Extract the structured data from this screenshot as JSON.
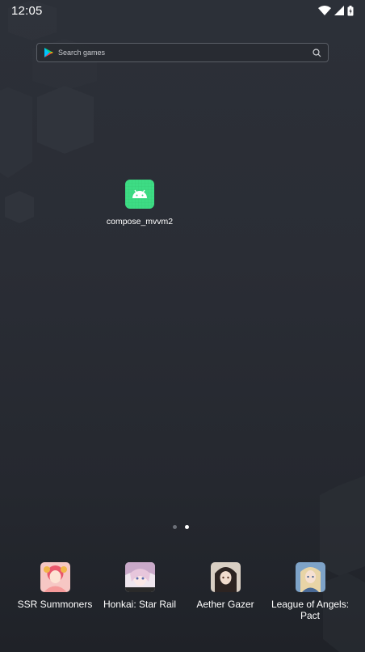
{
  "status_bar": {
    "time": "12:05",
    "icons": [
      "wifi-icon",
      "signal-icon",
      "battery-icon"
    ]
  },
  "search": {
    "placeholder": "Search games",
    "icons": [
      "play-store-icon",
      "search-icon"
    ]
  },
  "home_apps": [
    {
      "label": "compose_mvvm2",
      "icon": "android-icon",
      "color": "#3ddc84"
    }
  ],
  "page_indicator": {
    "pages": 2,
    "current": 2
  },
  "dock": [
    {
      "label": "SSR Summoners",
      "icon": "ssr-summoners-icon"
    },
    {
      "label": "Honkai: Star Rail",
      "icon": "honkai-star-rail-icon"
    },
    {
      "label": "Aether Gazer",
      "icon": "aether-gazer-icon"
    },
    {
      "label": "League of Angels: Pact",
      "icon": "league-of-angels-icon"
    }
  ],
  "colors": {
    "background": "#2a2d35",
    "accent_android": "#3ddc84"
  }
}
